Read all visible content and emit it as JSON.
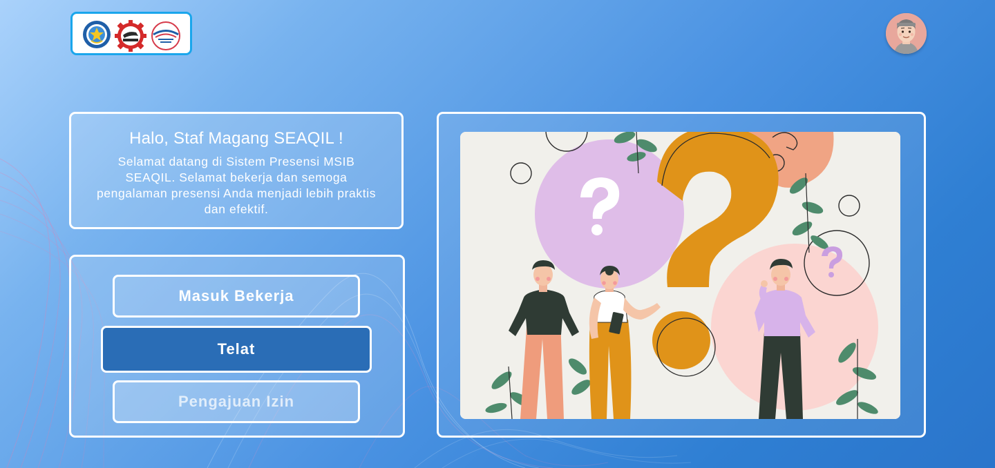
{
  "header": {
    "logos": [
      "kemendikbud-logo-icon",
      "seameo-logo-icon",
      "seameo-seaqil-logo-icon"
    ],
    "user_avatar": "user-avatar-icon"
  },
  "welcome": {
    "title": "Halo, Staf Magang SEAQIL !",
    "message": "Selamat datang di Sistem Presensi MSIB SEAQIL. Selamat bekerja dan semoga pengalaman presensi Anda menjadi lebih praktis dan efektif."
  },
  "actions": {
    "check_in_label": "Masuk Bekerja",
    "late_label": "Telat",
    "leave_request_label": "Pengajuan Izin",
    "selected": "Telat"
  },
  "illustration": {
    "icon": "question-people-illustration"
  },
  "colors": {
    "accent": "#2a6db6",
    "logo_border": "#1aa6ec",
    "panel_border": "#ffffff",
    "question_orange": "#e09319",
    "bubble_purple": "#dfbde8",
    "bubble_pink": "#fbd5d1",
    "leaf_green": "#4e8b6c"
  }
}
